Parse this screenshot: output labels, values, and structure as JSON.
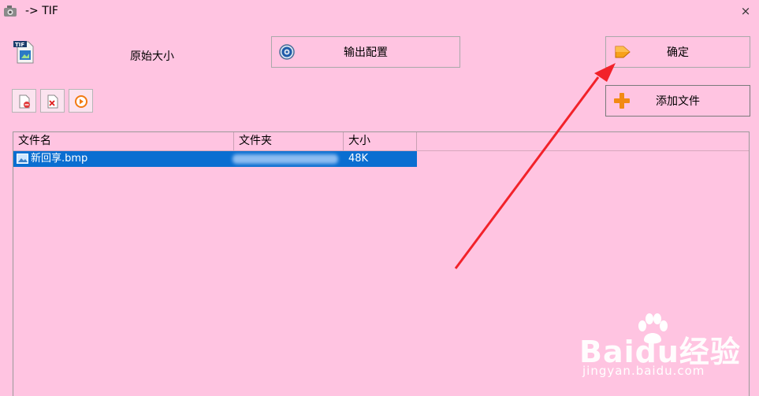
{
  "window": {
    "title": "-> TIF",
    "close_symbol": "×"
  },
  "toolbar": {
    "size_label": "原始大小",
    "output_config": "输出配置",
    "confirm": "确定",
    "add_file": "添加文件"
  },
  "list": {
    "columns": [
      "文件名",
      "文件夹",
      "大小"
    ],
    "rows": [
      {
        "name": "新回享.bmp",
        "size": "48K"
      }
    ]
  },
  "watermark": {
    "brand": "Baidu经验",
    "url": "jingyan.baidu.com"
  },
  "colors": {
    "background": "#ffc4e1",
    "selection": "#0a6ed1",
    "annotation_arrow": "#f2222a"
  }
}
